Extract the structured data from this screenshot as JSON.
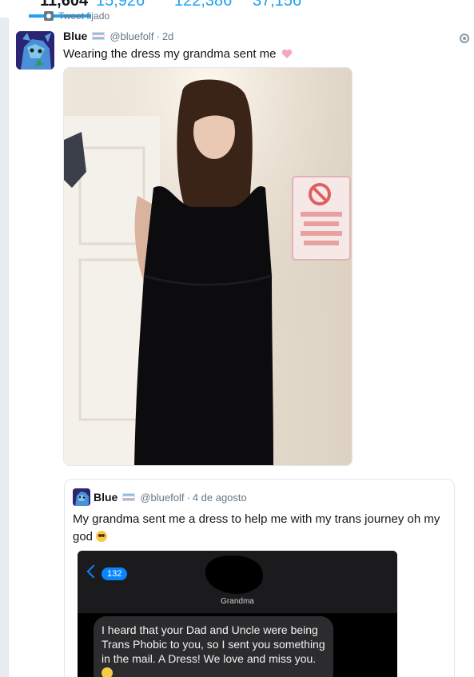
{
  "profile_stats": {
    "tweets": "11,604",
    "following": "15,926",
    "followers": "122,386",
    "likes": "37,156"
  },
  "pinned_label": "Tweet fijado",
  "tweet": {
    "name": "Blue",
    "handle": "@bluefolf",
    "time": "2d",
    "text": "Wearing the dress my grandma sent me",
    "emoji": "pink-heart-icon"
  },
  "quote": {
    "name": "Blue",
    "handle": "@bluefolf",
    "time": "4 de agosto",
    "text": "My grandma sent me a dress to help me with my trans journey oh my god",
    "emoji": "pleading-face-icon",
    "screenshot": {
      "back_count": "132",
      "contact_name": "Grandma",
      "message": "I heard that your Dad and Uncle were being Trans Phobic to you, so I sent you something in the mail. A Dress! We love and miss you."
    }
  },
  "colors": {
    "accent": "#1da1f2",
    "text": "#14171a",
    "muted": "#657786",
    "imessage_blue": "#0a84ff"
  }
}
